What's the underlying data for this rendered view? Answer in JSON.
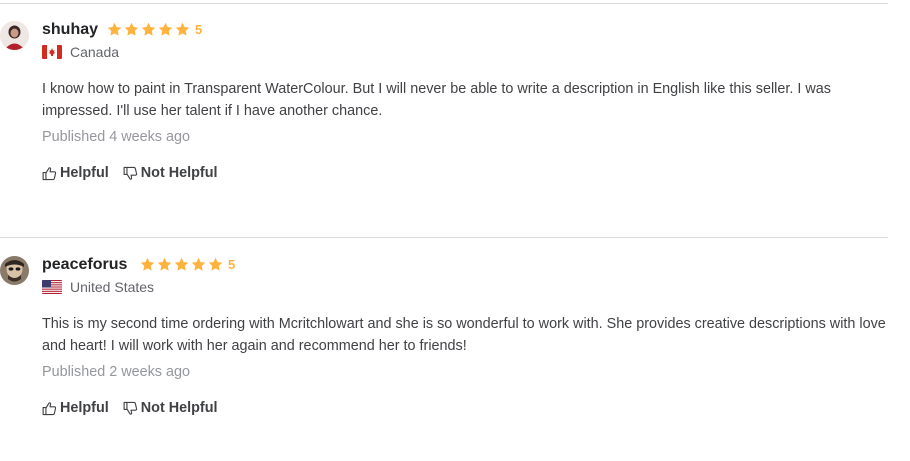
{
  "colors": {
    "star": "#ffb33e",
    "divider": "#dadbdd",
    "muted": "#95979d",
    "text": "#404145"
  },
  "reviews": [
    {
      "username": "shuhay",
      "rating": "5",
      "country": "Canada",
      "flag_icon": "canada-flag-icon",
      "text": "I know how to paint in Transparent WaterColour. But I will never be able to write a description in English like this seller. I was impressed. I'll use her talent if I have another chance.",
      "published": "Published 4 weeks ago",
      "helpful_label": "Helpful",
      "not_helpful_label": "Not Helpful"
    },
    {
      "username": "peaceforus",
      "rating": "5",
      "country": "United States",
      "flag_icon": "us-flag-icon",
      "text": "This is my second time ordering with Mcritchlowart and she is so wonderful to work with. She provides creative descriptions with love and heart! I will work with her again and recommend her to friends!",
      "published": "Published 2 weeks ago",
      "helpful_label": "Helpful",
      "not_helpful_label": "Not Helpful"
    }
  ]
}
